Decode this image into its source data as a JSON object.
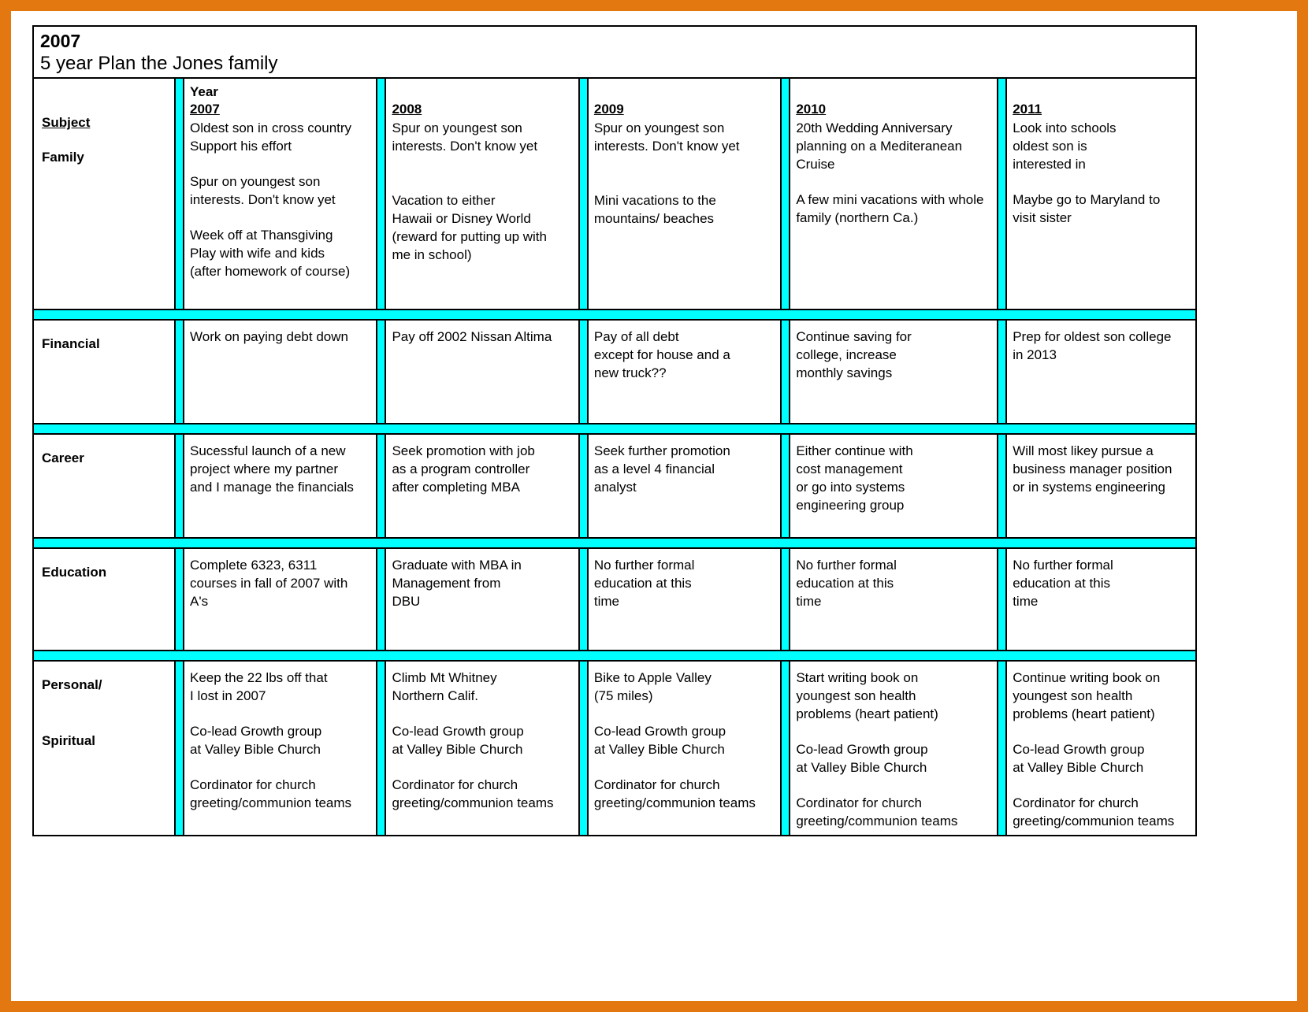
{
  "document": {
    "title_year": "2007",
    "title_subtitle": "5 year Plan the Jones family"
  },
  "colors": {
    "separator_cyan": "#00ffff",
    "page_border_orange": "#e2780f",
    "grid_black": "#000000"
  },
  "header": {
    "subject_label": "Subject",
    "year_word": "Year",
    "years": [
      "2007",
      "2008",
      "2009",
      "2010",
      "2011"
    ]
  },
  "rows": [
    {
      "subject": "Family",
      "subject_second": "",
      "cells": [
        {
          "paras": [
            "Oldest son in cross country\nSupport his effort",
            "Spur on youngest son\ninterests. Don't know yet",
            "Week off at Thansgiving\nPlay with wife and kids\n(after homework of course)"
          ]
        },
        {
          "paras": [
            "Spur on youngest son\ninterests. Don't know yet",
            "Vacation to either\nHawaii or Disney World\n(reward for putting up with\nme in school)"
          ],
          "big_gap_after_first": true
        },
        {
          "paras": [
            "Spur on youngest son\ninterests. Don't know yet",
            "Mini vacations to the\nmountains/ beaches"
          ],
          "big_gap_after_first": true
        },
        {
          "paras": [
            "20th Wedding Anniversary\nplanning on a Mediteranean\nCruise",
            "A few mini vacations with whole\nfamily (northern Ca.)"
          ]
        },
        {
          "paras": [
            "Look into schools\noldest son is\ninterested in",
            "Maybe go to Maryland to\nvisit sister"
          ]
        }
      ]
    },
    {
      "subject": "Financial",
      "subject_second": "",
      "cells": [
        {
          "paras": [
            "Work on paying debt down"
          ]
        },
        {
          "paras": [
            "Pay off 2002 Nissan Altima"
          ]
        },
        {
          "paras": [
            "Pay of all debt\nexcept for house and a\nnew truck??"
          ]
        },
        {
          "paras": [
            "Continue saving for\ncollege, increase\nmonthly savings"
          ]
        },
        {
          "paras": [
            "Prep for oldest son college\nin 2013"
          ]
        }
      ]
    },
    {
      "subject": "Career",
      "subject_second": "",
      "cells": [
        {
          "paras": [
            "Sucessful launch of a new\nproject where my partner\nand I manage the financials"
          ]
        },
        {
          "paras": [
            "Seek promotion with job\nas a program controller\nafter completing MBA"
          ]
        },
        {
          "paras": [
            "Seek further promotion\nas a level 4 financial\nanalyst"
          ]
        },
        {
          "paras": [
            "Either continue with\ncost management\nor go into systems\nengineering group"
          ]
        },
        {
          "paras": [
            "Will most likey pursue a\nbusiness manager position\nor in systems engineering"
          ]
        }
      ]
    },
    {
      "subject": "Education",
      "subject_second": "",
      "cells": [
        {
          "paras": [
            "Complete 6323, 6311\ncourses in fall of 2007 with\nA's"
          ]
        },
        {
          "paras": [
            "Graduate with MBA in\nManagement from\nDBU"
          ]
        },
        {
          "paras": [
            "No further formal\neducation at this\ntime"
          ]
        },
        {
          "paras": [
            "No further formal\neducation at this\ntime"
          ]
        },
        {
          "paras": [
            "No further formal\neducation at this\ntime"
          ]
        }
      ]
    },
    {
      "subject": "Personal/",
      "subject_second": "Spiritual",
      "cells": [
        {
          "paras": [
            "Keep the 22 lbs off that\nI lost in 2007",
            "Co-lead Growth group\nat Valley Bible Church",
            "Cordinator for church\ngreeting/communion teams"
          ]
        },
        {
          "paras": [
            "Climb Mt Whitney\nNorthern Calif.",
            "Co-lead Growth group\nat Valley Bible Church",
            "Cordinator for church\ngreeting/communion teams"
          ]
        },
        {
          "paras": [
            "Bike to Apple Valley\n(75 miles)",
            "Co-lead Growth group\nat Valley Bible Church",
            "Cordinator for church\ngreeting/communion teams"
          ]
        },
        {
          "shift_down": true,
          "paras": [
            "Start writing book on\nyoungest son health\nproblems (heart patient)",
            "Co-lead Growth group\nat Valley Bible Church",
            "Cordinator for church\ngreeting/communion teams"
          ]
        },
        {
          "shift_down": true,
          "paras": [
            "Continue writing book on\nyoungest son health\nproblems (heart patient)",
            "Co-lead Growth group\nat Valley Bible Church",
            "Cordinator for church\ngreeting/communion teams"
          ]
        }
      ]
    }
  ]
}
